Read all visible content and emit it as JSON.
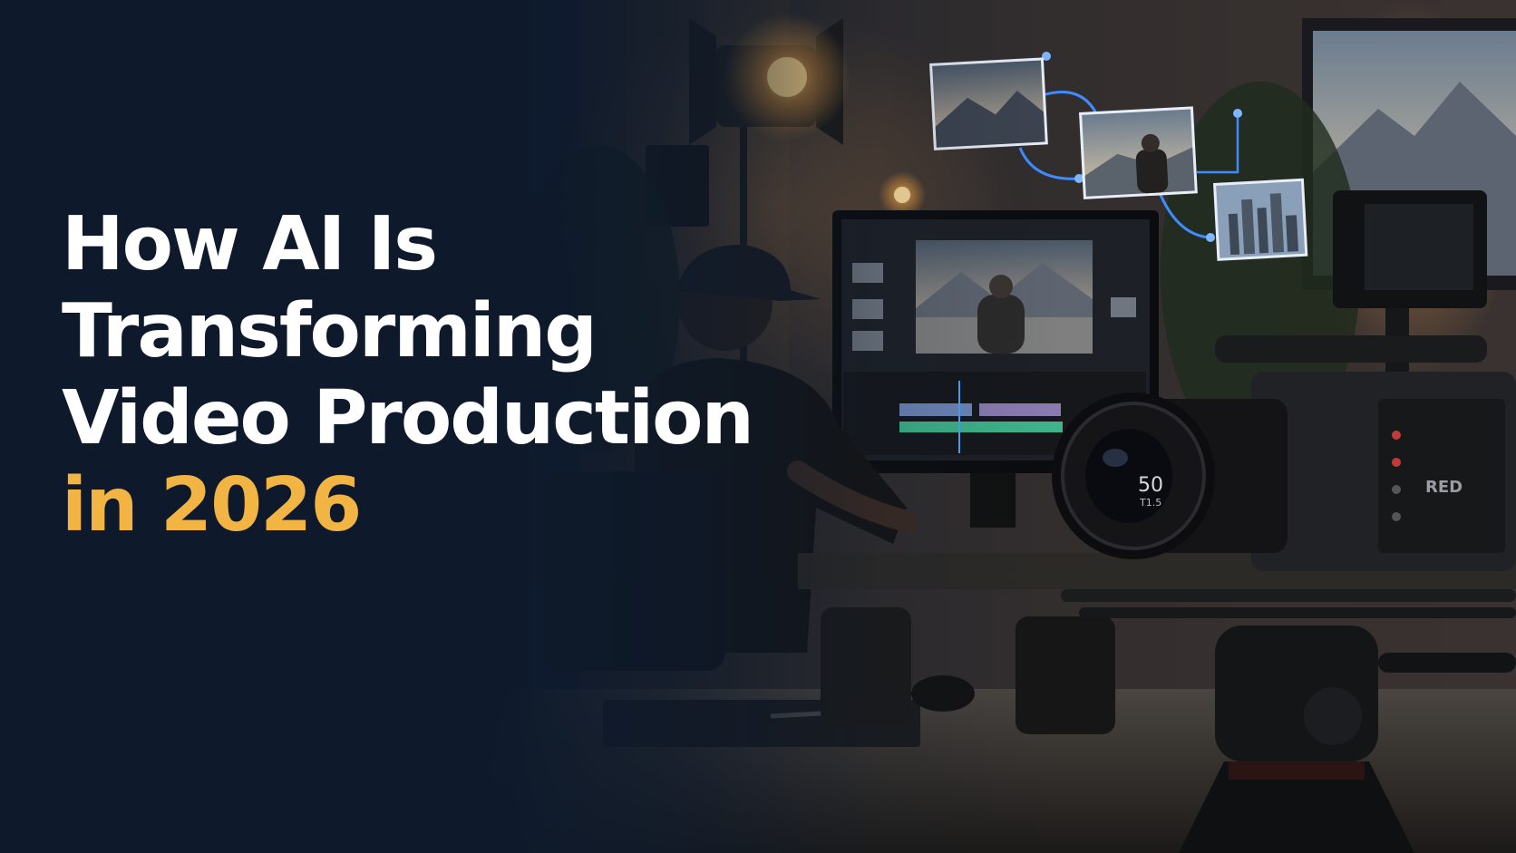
{
  "headline": {
    "line1": "How AI Is",
    "line2": "Transforming",
    "line3": "Video Production",
    "line4": "in 2026"
  },
  "camera": {
    "lens_focal": "50",
    "lens_aperture": "T1.5",
    "brand": "RED"
  },
  "colors": {
    "background": "#0e1a2c",
    "headline_text": "#ffffff",
    "accent": "#f2b544",
    "ui_glow": "#3f8cff"
  }
}
